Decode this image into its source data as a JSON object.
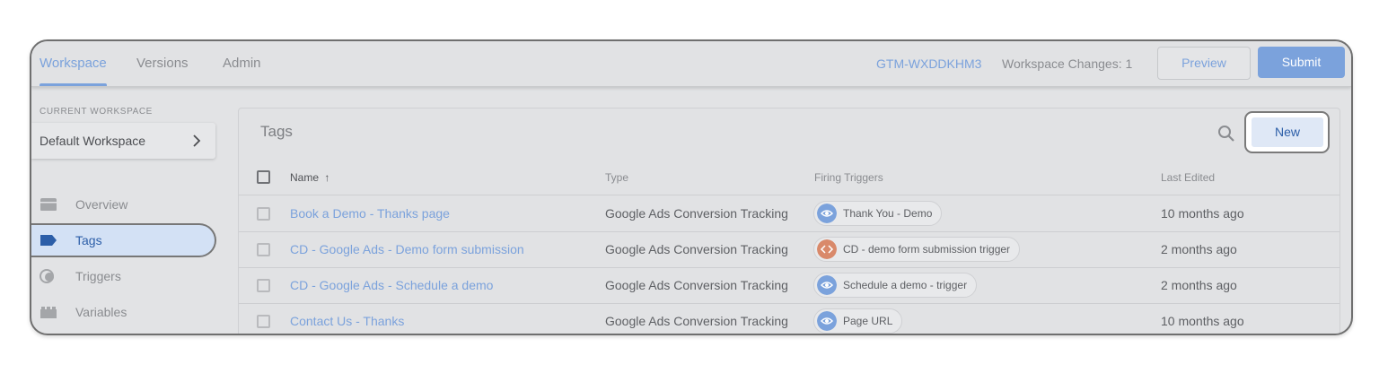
{
  "nav_tabs": [
    {
      "label": "Workspace",
      "active": true
    },
    {
      "label": "Versions",
      "active": false
    },
    {
      "label": "Admin",
      "active": false
    }
  ],
  "header": {
    "container_id": "GTM-WXDDKHM3",
    "workspace_changes": "Workspace Changes: 1",
    "preview_label": "Preview",
    "submit_label": "Submit"
  },
  "sidebar": {
    "current_workspace_label": "CURRENT WORKSPACE",
    "workspace_name": "Default Workspace",
    "items": [
      {
        "label": "Overview",
        "icon": "folder-icon",
        "active": false
      },
      {
        "label": "Tags",
        "icon": "tag-icon",
        "active": true
      },
      {
        "label": "Triggers",
        "icon": "trigger-icon",
        "active": false
      },
      {
        "label": "Variables",
        "icon": "variables-icon",
        "active": false
      }
    ]
  },
  "main": {
    "title": "Tags",
    "new_label": "New",
    "columns": {
      "name": "Name",
      "type": "Type",
      "triggers": "Firing Triggers",
      "edited": "Last Edited"
    },
    "rows": [
      {
        "name": "Book a Demo - Thanks page",
        "type": "Google Ads Conversion Tracking",
        "trigger": "Thank You - Demo",
        "trigger_icon": "eye-icon",
        "trigger_color": "#7ba2dc",
        "edited": "10 months ago"
      },
      {
        "name": "CD - Google Ads - Demo form submission",
        "type": "Google Ads Conversion Tracking",
        "trigger": "CD - demo form submission trigger",
        "trigger_icon": "code-icon",
        "trigger_color": "#d9896a",
        "edited": "2 months ago"
      },
      {
        "name": "CD - Google Ads - Schedule a demo",
        "type": "Google Ads Conversion Tracking",
        "trigger": "Schedule a demo - trigger",
        "trigger_icon": "eye-icon",
        "trigger_color": "#7ba2dc",
        "edited": "2 months ago"
      },
      {
        "name": "Contact Us - Thanks",
        "type": "Google Ads Conversion Tracking",
        "trigger": "Page URL",
        "trigger_icon": "eye-icon",
        "trigger_color": "#7ba2dc",
        "edited": "10 months ago"
      }
    ]
  },
  "colors": {
    "accent": "#7ba2dc",
    "active_nav": "#2c5ea8",
    "code_trigger": "#d9896a"
  }
}
